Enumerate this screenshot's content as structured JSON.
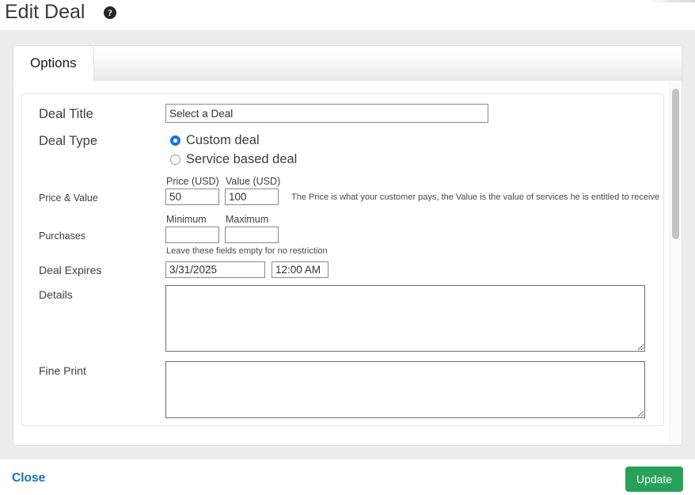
{
  "header": {
    "title": "Edit Deal",
    "help_icon": "help-circle-icon",
    "help_symbol": "?"
  },
  "tabs": [
    {
      "label": "Options",
      "active": true
    }
  ],
  "form": {
    "deal_title": {
      "label": "Deal Title",
      "value": "Select a Deal",
      "placeholder": ""
    },
    "deal_type": {
      "label": "Deal Type",
      "options": [
        {
          "label": "Custom deal",
          "selected": true
        },
        {
          "label": "Service based deal",
          "selected": false
        }
      ]
    },
    "price_value": {
      "label": "Price & Value",
      "price_label": "Price (USD)",
      "price_value": "50",
      "value_label": "Value (USD)",
      "value_value": "100",
      "hint": "The Price is what your customer pays, the Value is the value of services he is entitled to receive"
    },
    "purchases": {
      "label": "Purchases",
      "min_label": "Minimum",
      "min_value": "",
      "max_label": "Maximum",
      "max_value": "",
      "hint": "Leave these fields empty for no restriction"
    },
    "deal_expires": {
      "label": "Deal Expires",
      "date_value": "3/31/2025",
      "time_value": "12:00 AM"
    },
    "details": {
      "label": "Details",
      "value": ""
    },
    "fine_print": {
      "label": "Fine Print",
      "value": ""
    }
  },
  "footer": {
    "close_label": "Close",
    "update_label": "Update"
  },
  "colors": {
    "accent_green": "#27a15a",
    "link_blue": "#1275c4",
    "radio_blue": "#1a73e8",
    "page_gray": "#ededed"
  }
}
